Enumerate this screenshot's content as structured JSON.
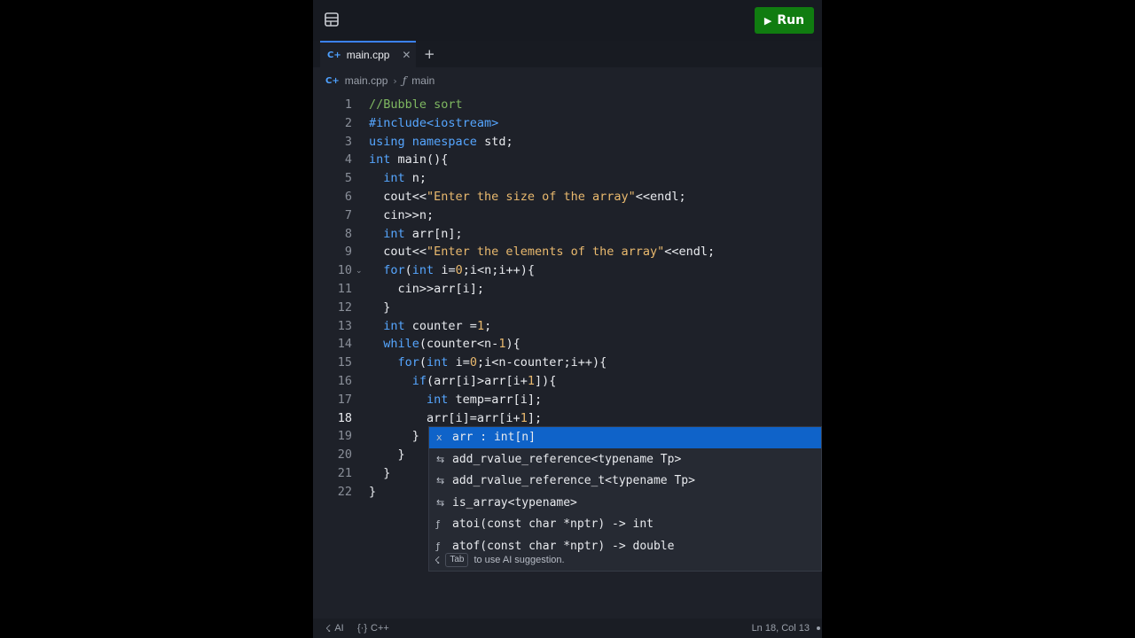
{
  "header": {
    "run_label": "Run"
  },
  "tabs": {
    "active_file": "main.cpp"
  },
  "breadcrumb": {
    "file": "main.cpp",
    "symbol": "main"
  },
  "editor": {
    "lines": [
      "//Bubble sort",
      "#include<iostream>",
      "using namespace std;",
      "int main(){",
      "  int n;",
      "  cout<<\"Enter the size of the array\"<<endl;",
      "  cin>>n;",
      "  int arr[n];",
      "  cout<<\"Enter the elements of the array\"<<endl;",
      "  for(int i=0;i<n;i++){",
      "    cin>>arr[i];",
      "  }",
      "  int counter =1;",
      "  while(counter<n-1){",
      "    for(int i=0;i<n-counter;i++){",
      "      if(arr[i]>arr[i+1]){",
      "        int temp=arr[i];",
      "        arr[i]=arr[i+1];",
      "      }",
      "    }",
      "  }",
      "}"
    ],
    "current_line": 18
  },
  "autocomplete": {
    "items": [
      {
        "icon": "variable-icon",
        "text": "arr : int[n]"
      },
      {
        "icon": "type-icon",
        "text": "add_rvalue_reference<typename Tp>"
      },
      {
        "icon": "type-icon",
        "text": "add_rvalue_reference_t<typename Tp>"
      },
      {
        "icon": "type-icon",
        "text": "is_array<typename>"
      },
      {
        "icon": "function-icon",
        "text": "atoi(const char *nptr) -> int"
      },
      {
        "icon": "function-icon",
        "text": "atof(const char *nptr) -> double"
      }
    ],
    "hint_key": "Tab",
    "hint_text": "to use AI suggestion."
  },
  "status": {
    "ai": "AI",
    "language": "C++",
    "position": "Ln 18, Col 13"
  },
  "colors": {
    "run_button": "#107c10",
    "keyword": "#56a6ff",
    "string": "#e9b96e",
    "comment": "#7fb861",
    "selection": "#0f63c9"
  }
}
